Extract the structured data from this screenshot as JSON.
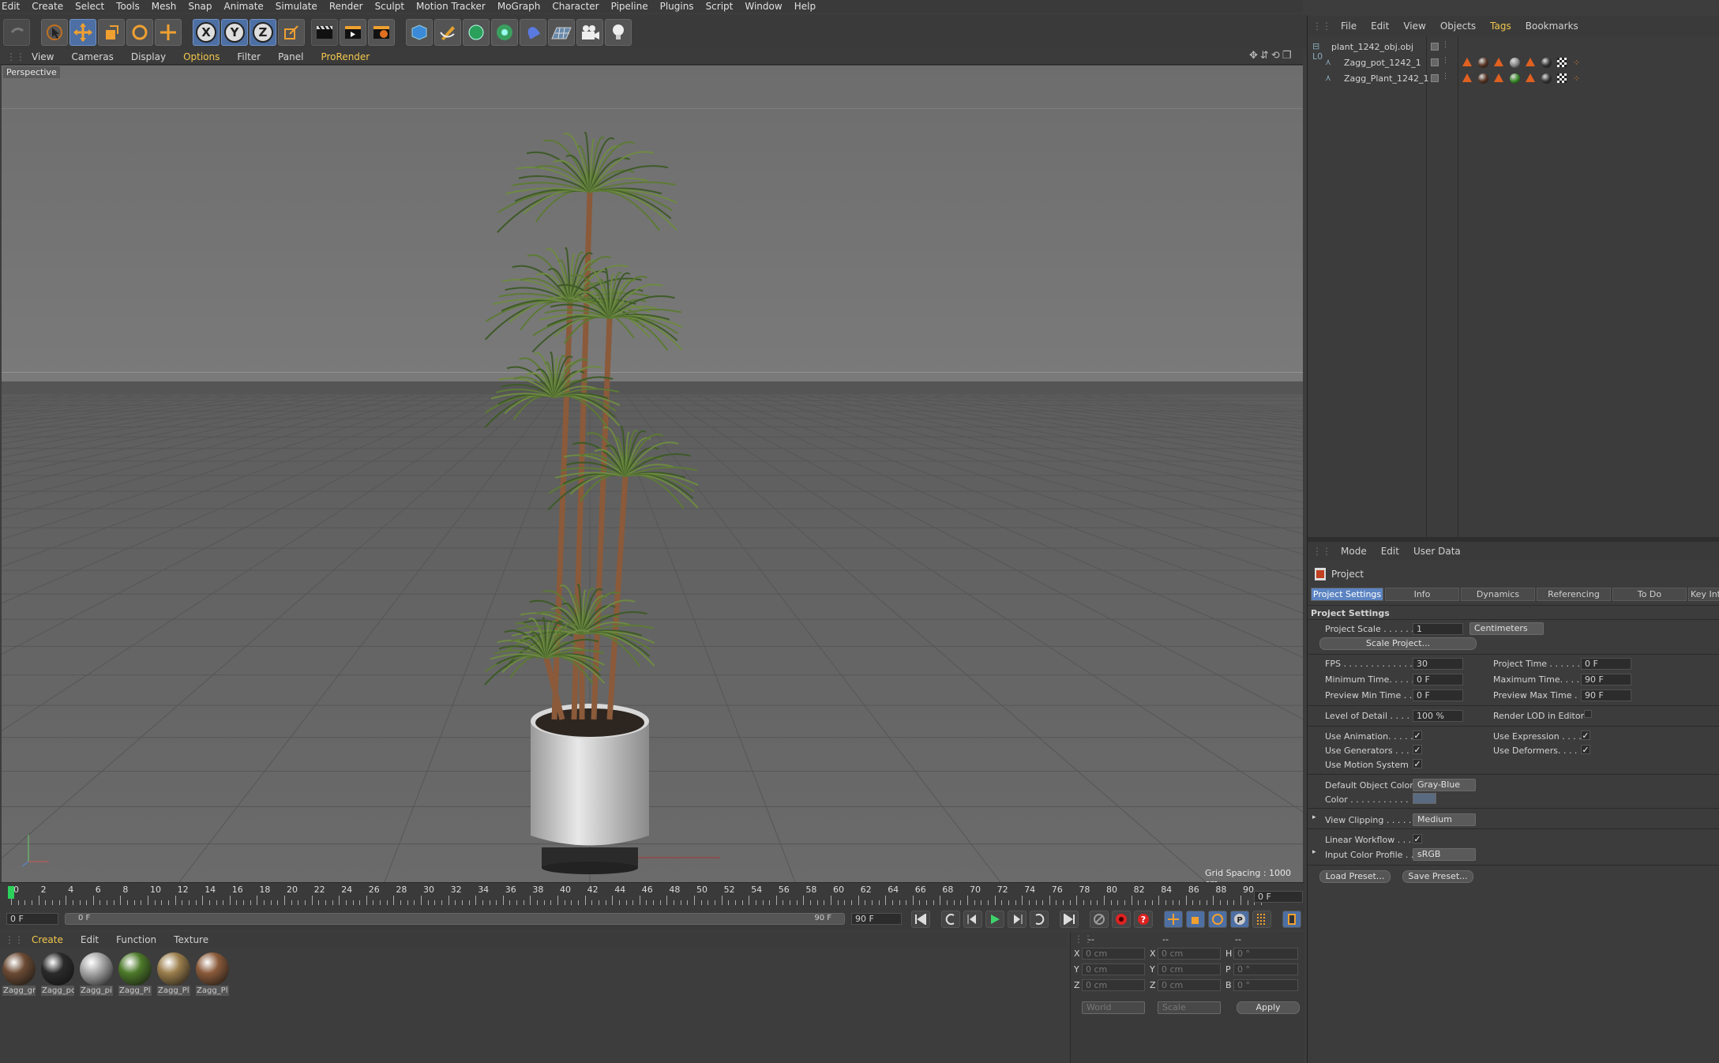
{
  "menubar": [
    "Edit",
    "Create",
    "Select",
    "Tools",
    "Mesh",
    "Snap",
    "Animate",
    "Simulate",
    "Render",
    "Sculpt",
    "Motion Tracker",
    "MoGraph",
    "Character",
    "Pipeline",
    "Plugins",
    "Script",
    "Window",
    "Help"
  ],
  "toolbar": {
    "axis_x": "X",
    "axis_y": "Y",
    "axis_z": "Z"
  },
  "viewport_menu": [
    "View",
    "Cameras",
    "Display",
    "Options",
    "Filter",
    "Panel",
    "ProRender"
  ],
  "viewport": {
    "label": "Perspective",
    "grid_spacing": "Grid Spacing : 1000 cm"
  },
  "timeline": {
    "ticks": [
      "0",
      "2",
      "4",
      "6",
      "8",
      "10",
      "12",
      "14",
      "16",
      "18",
      "20",
      "22",
      "24",
      "26",
      "28",
      "30",
      "32",
      "34",
      "36",
      "38",
      "40",
      "42",
      "44",
      "46",
      "48",
      "50",
      "52",
      "54",
      "56",
      "58",
      "60",
      "62",
      "64",
      "66",
      "68",
      "70",
      "72",
      "74",
      "76",
      "78",
      "80",
      "82",
      "84",
      "86",
      "88",
      "90"
    ],
    "current_frame": "0 F"
  },
  "transport": {
    "start": "0 F",
    "slider_start": "0 F",
    "slider_end": "90 F",
    "end": "90 F"
  },
  "material_menu": [
    "Create",
    "Edit",
    "Function",
    "Texture"
  ],
  "materials": [
    {
      "label": "Zagg_gr",
      "color": "#6b4a33"
    },
    {
      "label": "Zagg_pc",
      "color": "#2a2a2a"
    },
    {
      "label": "Zagg_pi",
      "color": "#a8a8a8"
    },
    {
      "label": "Zagg_Pl",
      "color": "#4d7a2a"
    },
    {
      "label": "Zagg_Pl",
      "color": "#9b7e4c"
    },
    {
      "label": "Zagg_Pl",
      "color": "#8a5a3a"
    }
  ],
  "coords": {
    "headers": [
      "--",
      "--",
      "--"
    ],
    "rows": [
      {
        "a": "X",
        "av": "0 cm",
        "b": "X",
        "bv": "0 cm",
        "c": "H",
        "cv": "0 °"
      },
      {
        "a": "Y",
        "av": "0 cm",
        "b": "Y",
        "bv": "0 cm",
        "c": "P",
        "cv": "0 °"
      },
      {
        "a": "Z",
        "av": "0 cm",
        "b": "Z",
        "bv": "0 cm",
        "c": "B",
        "cv": "0 °"
      }
    ],
    "world": "World",
    "scale": "Scale",
    "apply": "Apply"
  },
  "objects_menu": [
    "File",
    "Edit",
    "View",
    "Objects",
    "Tags",
    "Bookmarks"
  ],
  "objects": [
    {
      "name": "plant_1242_obj.obj"
    },
    {
      "name": "Zagg_pot_1242_1"
    },
    {
      "name": "Zagg_Plant_1242_1"
    }
  ],
  "attr_menu": [
    "Mode",
    "Edit",
    "User Data"
  ],
  "attr": {
    "title": "Project",
    "tabs": [
      "Project Settings",
      "Info",
      "Dynamics",
      "Referencing",
      "To Do",
      "Key Int"
    ],
    "section": "Project Settings",
    "project_scale_label": "Project Scale . . . . . .",
    "project_scale": "1",
    "units": "Centimeters",
    "scale_project_btn": "Scale Project...",
    "fps_label": "FPS . . . . . . . . . . . . . .",
    "fps": "30",
    "project_time_label": "Project Time . . . . . . . .",
    "project_time": "0 F",
    "min_time_label": "Minimum Time. . . . .",
    "min_time": "0 F",
    "max_time_label": "Maximum Time. . . . . .",
    "max_time": "90 F",
    "prev_min_label": "Preview Min Time . .",
    "prev_min": "0 F",
    "prev_max_label": "Preview Max Time . . .",
    "prev_max": "90 F",
    "lod_label": "Level of Detail . . . . .",
    "lod": "100 %",
    "render_lod_label": "Render LOD in Editor",
    "use_animation": "Use Animation. . . . .",
    "use_expression": "Use Expression . . . . .",
    "use_generators": "Use Generators . . . .",
    "use_deformers": "Use Deformers. . . . .",
    "use_motion": "Use Motion System",
    "default_color_label": "Default Object Color",
    "default_color": "Gray-Blue",
    "color_label": "Color . . . . . . . . . . .",
    "view_clipping_label": "View Clipping . . . . . .",
    "view_clipping": "Medium",
    "linear_label": "Linear Workflow . . .",
    "icp_label": "Input Color Profile . .",
    "icp": "sRGB",
    "load_preset": "Load Preset...",
    "save_preset": "Save Preset...",
    "check": "✓"
  }
}
